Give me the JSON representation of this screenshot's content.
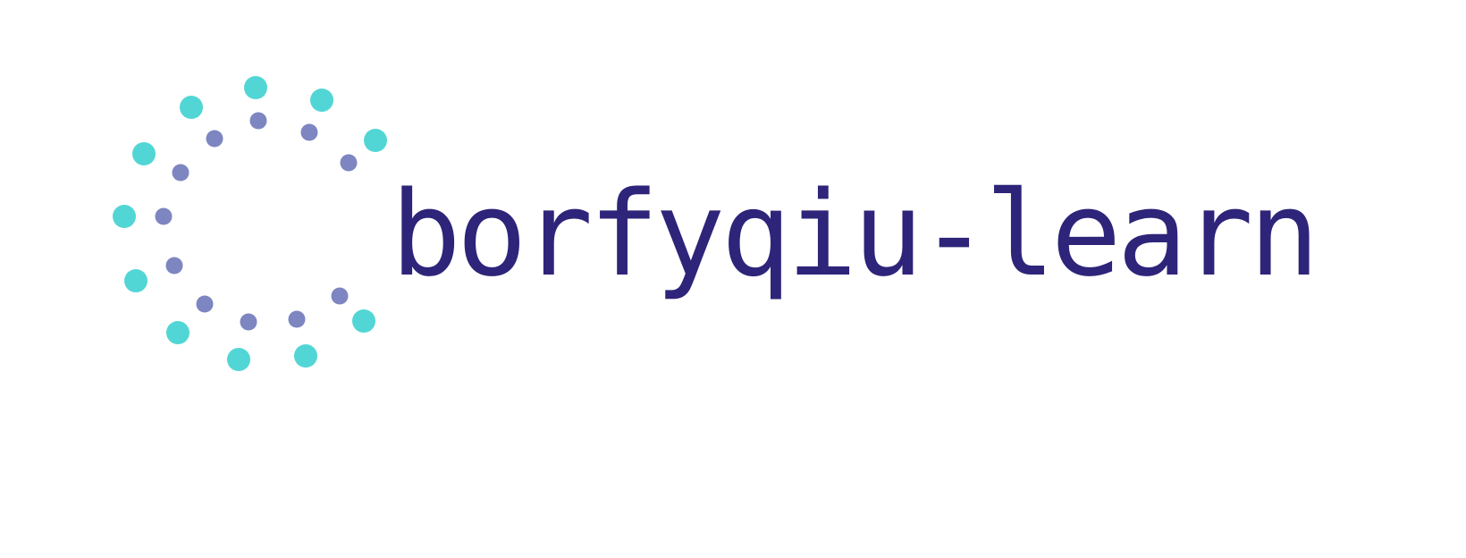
{
  "brand": {
    "name": "borfyqiu-learn",
    "text_color": "#2e2479"
  },
  "logo": {
    "icon": "dotted-circle-logo-icon",
    "outer_dot_color": "#52d6d5",
    "inner_dot_color": "#7d86c1"
  }
}
